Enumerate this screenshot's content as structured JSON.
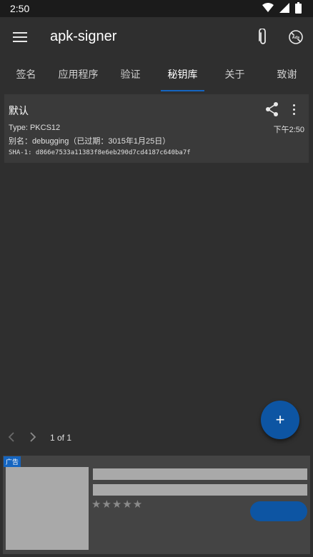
{
  "status_bar": {
    "time": "2:50"
  },
  "app_bar": {
    "title": "apk-signer"
  },
  "tabs": [
    {
      "label": "签名"
    },
    {
      "label": "应用程序"
    },
    {
      "label": "验证"
    },
    {
      "label": "秘钥库",
      "active": true
    },
    {
      "label": "关于"
    },
    {
      "label": "致谢"
    }
  ],
  "keystore_card": {
    "title": "默认",
    "type": "Type: PKCS12",
    "time": "下午2:50",
    "alias": "别名：debugging（已过期：3015年1月25日）",
    "sha1": "SHA-1: d866e7533a11383f8e6eb290d7cd4187c640ba7f"
  },
  "pager": {
    "text": "1 of 1"
  },
  "fab": {
    "label": "+"
  },
  "ad": {
    "badge": "广告",
    "stars": "★★★★★"
  },
  "colors": {
    "accent": "#1565c0",
    "background": "#2f2f2f",
    "card": "#3a3a3a"
  }
}
